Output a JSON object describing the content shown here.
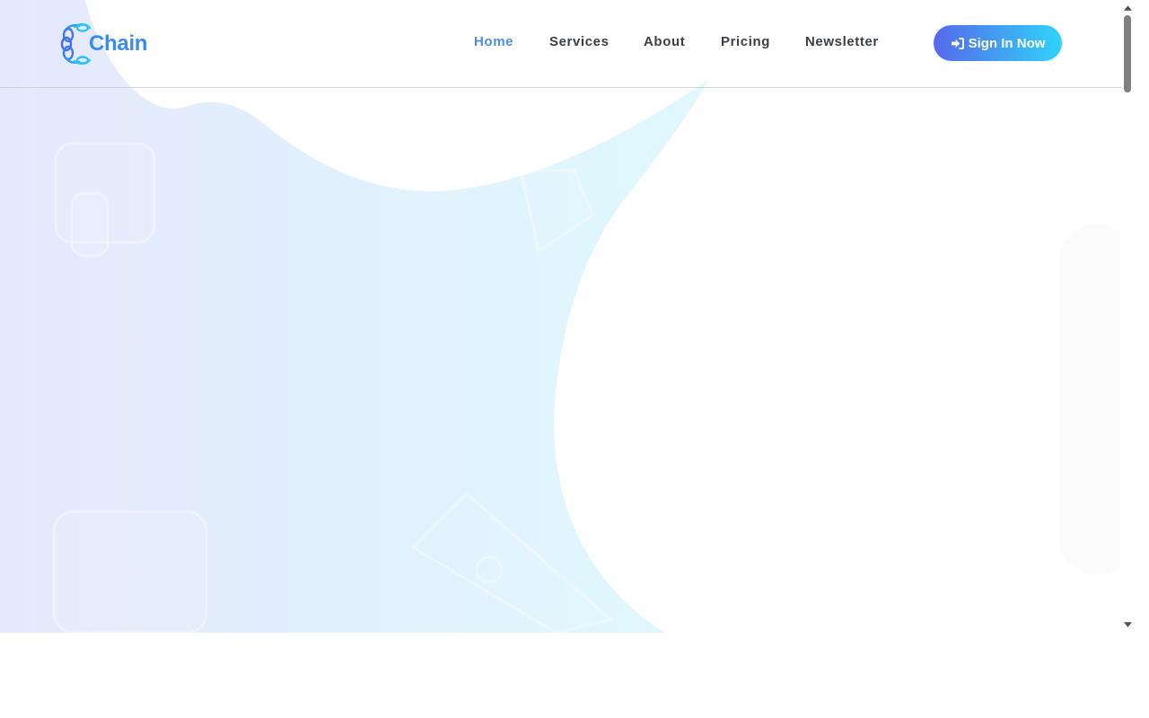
{
  "header": {
    "logo_text": "Chain",
    "logo_icon": "chain-link-icon",
    "nav": [
      {
        "label": "Home",
        "active": true
      },
      {
        "label": "Services",
        "active": false
      },
      {
        "label": "About",
        "active": false
      },
      {
        "label": "Pricing",
        "active": false
      },
      {
        "label": "Newsletter",
        "active": false
      }
    ],
    "signin_label": "Sign In Now",
    "signin_icon": "sign-in-icon"
  },
  "colors": {
    "brand": "#3b8af0",
    "nav_text": "#3a3f47",
    "nav_active": "#4a90e2",
    "button_gradient_start": "#5569ea",
    "button_gradient_end": "#2fd3fb",
    "hero_blob_start": "#e6eafc",
    "hero_blob_end": "#e2f8fd"
  }
}
